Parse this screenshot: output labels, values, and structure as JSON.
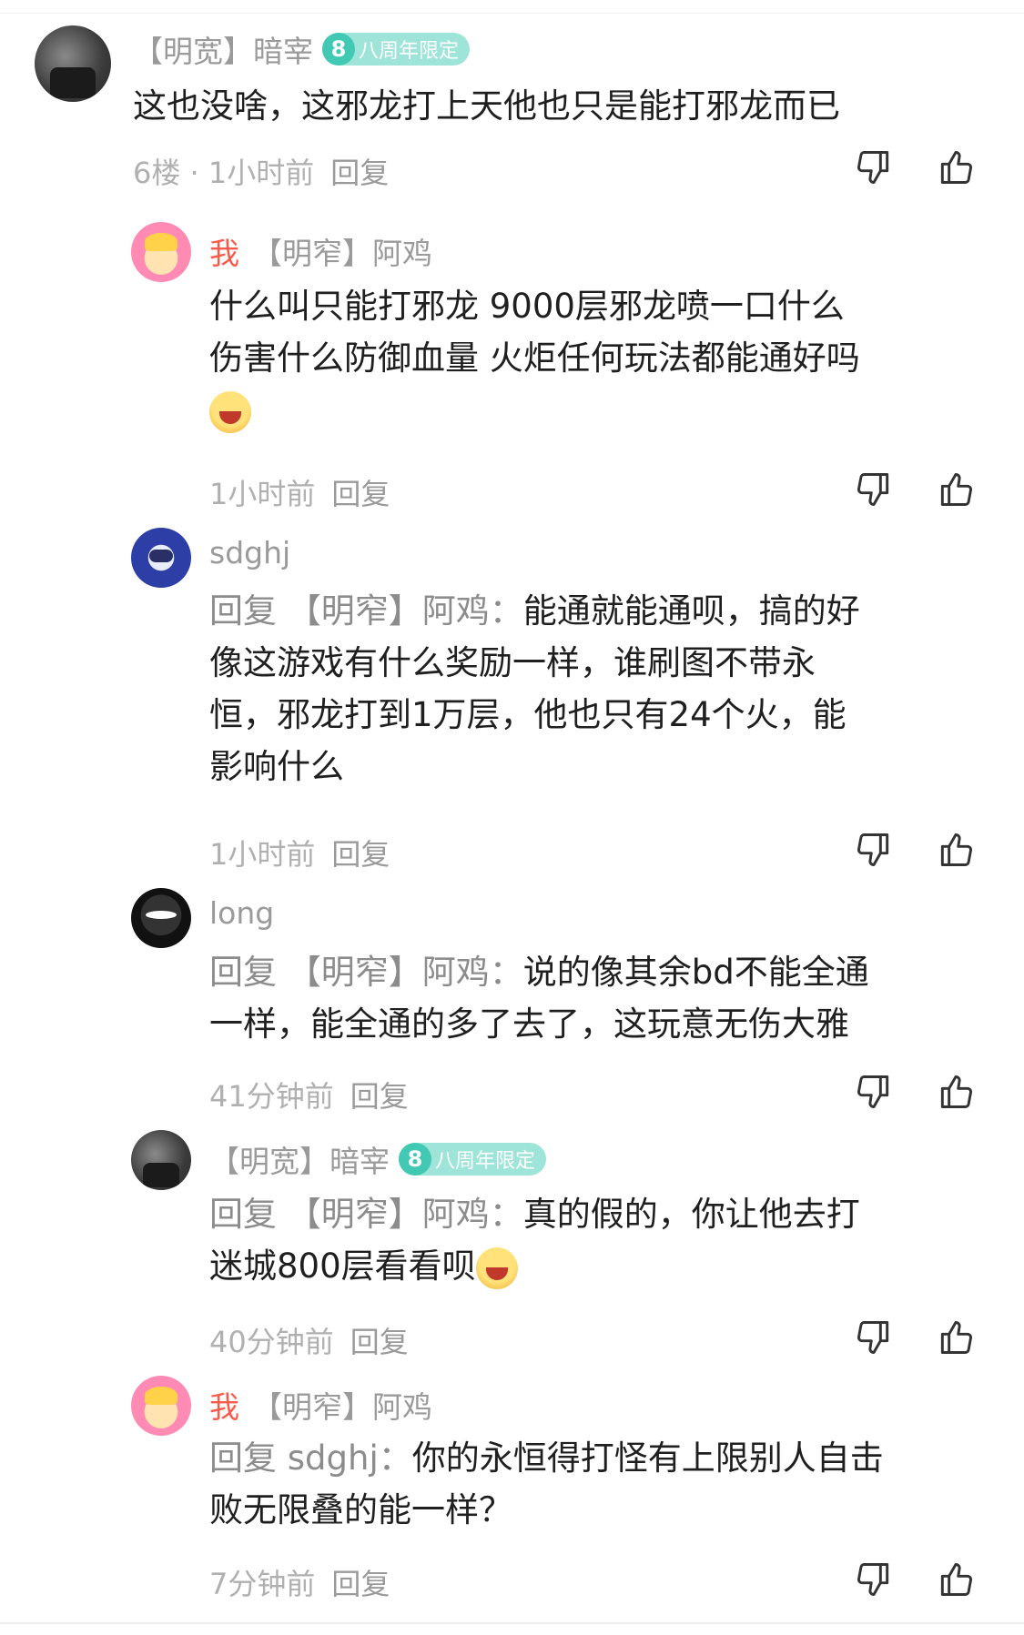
{
  "comments": [
    {
      "author": "【明宽】暗宰",
      "badge": {
        "num": "8",
        "label": "八周年限定"
      },
      "text_lines": [
        "这也没啥，这邪龙打上天他也只是能打邪龙而已"
      ],
      "floor": "6楼 · 1小时前",
      "reply": "回复"
    },
    {
      "me": "我",
      "author": "【明窄】阿鸡",
      "text_lines": [
        "什么叫只能打邪龙 9000层邪龙喷一口什么",
        "伤害什么防御血量 火炬任何玩法都能通好吗"
      ],
      "time": "1小时前",
      "reply": "回复"
    },
    {
      "author": "sdghj",
      "reply_prefix": "回复 【明窄】阿鸡：",
      "text_lines": [
        "能通就能通呗，搞的好",
        "像这游戏有什么奖励一样，谁刷图不带永",
        "恒，邪龙打到1万层，他也只有24个火，能",
        "影响什么"
      ],
      "time": "1小时前",
      "reply": "回复"
    },
    {
      "author": "long",
      "reply_prefix": "回复 【明窄】阿鸡：",
      "text_lines": [
        "说的像其余bd不能全通",
        "一样，能全通的多了去了，这玩意无伤大雅"
      ],
      "time": "41分钟前",
      "reply": "回复"
    },
    {
      "author": "【明宽】暗宰",
      "badge": {
        "num": "8",
        "label": "八周年限定"
      },
      "reply_prefix": "回复 【明窄】阿鸡：",
      "text_lines": [
        "真的假的，你让他去打",
        "迷城800层看看呗"
      ],
      "time": "40分钟前",
      "reply": "回复"
    },
    {
      "me": "我",
      "author": "【明窄】阿鸡",
      "reply_prefix": "回复 sdghj：",
      "text_lines": [
        "你的永恒得打怪有上限别人自击",
        "败无限叠的能一样？"
      ],
      "time": "7分钟前",
      "reply": "回复"
    }
  ],
  "icons": {
    "dislike": "thumbs-down-icon",
    "like": "thumbs-up-icon"
  },
  "colors": {
    "me": "#fa5a4a",
    "badge": "#9ee4d8",
    "meta": "#b0b0b0"
  }
}
